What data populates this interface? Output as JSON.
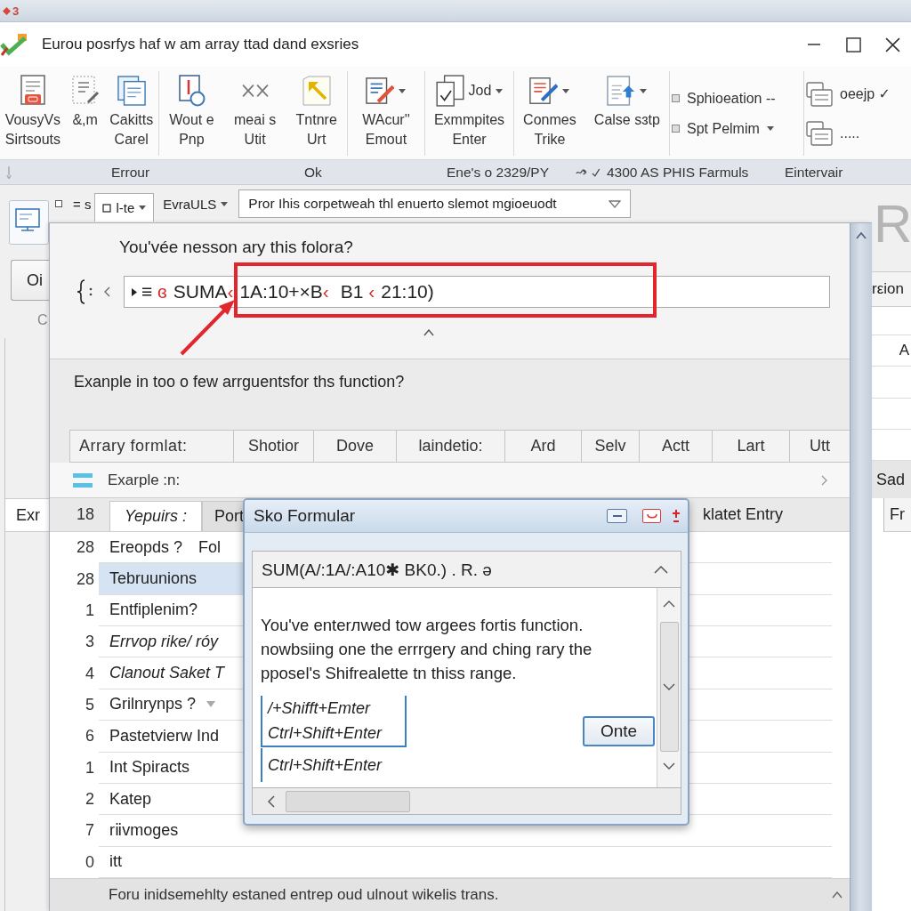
{
  "title_strip": {
    "label": "3"
  },
  "window": {
    "title": "Eurou posrfys haf w am array ttad dand exsries"
  },
  "ribbon": {
    "groups": [
      {
        "kind": "large",
        "buttons": [
          {
            "lines": [
              "VousyVs",
              "Sirtsouts"
            ],
            "dropdown": false
          },
          {
            "lines": [
              "&,m"
            ],
            "dropdown": false
          },
          {
            "lines": [
              "Cakitts",
              "Carel"
            ],
            "dropdown": false
          }
        ]
      },
      {
        "kind": "large",
        "buttons": [
          {
            "lines": [
              "Wout e",
              "Pnp"
            ],
            "dropdown": false
          },
          {
            "lines": [
              "meai s",
              "Utit"
            ],
            "dropdown": false
          },
          {
            "lines": [
              "Tntnre",
              "Urt"
            ],
            "dropdown": false
          }
        ]
      },
      {
        "kind": "large",
        "buttons": [
          {
            "lines": [
              "WAcur''",
              "Emout"
            ],
            "dropdown": true
          }
        ]
      },
      {
        "kind": "large",
        "buttons": [
          {
            "side_label": "Jod",
            "lines": [
              "Exmmpites",
              "Enter"
            ],
            "dropdown": true
          }
        ]
      },
      {
        "kind": "large",
        "buttons": [
          {
            "lines": [
              "Conmes",
              "Trike"
            ],
            "dropdown": true
          },
          {
            "lines": [
              "Calse sɜtp"
            ],
            "dropdown": true
          }
        ]
      },
      {
        "kind": "compact",
        "buttons": [
          {
            "lines": [
              "Sphioeation --"
            ],
            "dropdown": false
          },
          {
            "lines": [
              "Spt Pelmim"
            ],
            "dropdown": true
          }
        ]
      },
      {
        "kind": "compact",
        "buttons": [
          {
            "lines": [
              "oeejp ✓"
            ],
            "dropdown": false
          },
          {
            "lines": [
              "....."
            ],
            "dropdown": false
          }
        ]
      }
    ],
    "group_labels": [
      "Errour",
      "Ok",
      "Ene's o 2329/PY",
      "4300 AS PHIS Farmuls",
      "Eintervair"
    ]
  },
  "workspace": {
    "toolbar": {
      "label": "= s",
      "dropdowns": [
        {
          "kind": "boxed",
          "value": "l-te"
        },
        {
          "kind": "plain",
          "value": "EvraULS"
        }
      ],
      "combo": "Pror Ihis corpetweah thl enuerto slemot mgioeuodt"
    },
    "left": {
      "button": "Oi",
      "letter": "C",
      "tab": "Exr"
    },
    "right": {
      "letter": "R",
      "button": "rεion",
      "cell": "A",
      "band": "Sad",
      "tab": "Fr"
    }
  },
  "panel": {
    "question": "You'vée nesson ary this folora?",
    "formula": [
      {
        "text": "≡ ",
        "error": false
      },
      {
        "text": "ɞ",
        "error": true
      },
      {
        "text": "SUMA",
        "error": false
      },
      {
        "text": "‹",
        "error": true
      },
      {
        "text": "1A:10+×B",
        "error": false
      },
      {
        "text": "‹",
        "error": true
      },
      {
        "text": " B1 ",
        "error": false
      },
      {
        "text": "‹",
        "error": true
      },
      {
        "text": "21:10)",
        "error": false
      }
    ],
    "hint": "Exanple in too o few arrguentsfor ths function?",
    "columns": [
      "Arrary formlat:",
      "Shotior",
      "Dove",
      "laindetio:",
      "Ard",
      "Selv",
      "Actt",
      "Lart",
      "Utt"
    ],
    "section": "Exarple :n:",
    "tab_row": {
      "number": "18",
      "tabs": [
        {
          "label": "Yepuirs :",
          "selected": true
        },
        {
          "label": "Port",
          "selected": false
        }
      ],
      "trailing": "klatet Entry"
    },
    "rows": [
      {
        "number": "28",
        "label": "Ereopds ?",
        "extra": "Fol",
        "selected": false,
        "italic": false,
        "dropdown": false
      },
      {
        "number": "28",
        "label": "Tebruunions",
        "selected": true,
        "italic": false,
        "dropdown": false
      },
      {
        "number": "1",
        "label": "Entfiplenim?",
        "selected": false,
        "italic": false,
        "dropdown": false
      },
      {
        "number": "3",
        "label": "Errvop rike/ róy",
        "selected": false,
        "italic": true,
        "dropdown": false
      },
      {
        "number": "4",
        "label": "Clanout Saket T",
        "selected": false,
        "italic": true,
        "dropdown": false
      },
      {
        "number": "5",
        "label": "Grilnrynps ?",
        "selected": false,
        "italic": false,
        "dropdown": true
      },
      {
        "number": "6",
        "label": "Pastetvierw Ind",
        "selected": false,
        "italic": false,
        "dropdown": false
      },
      {
        "number": "1",
        "label": "Int Spiracts",
        "selected": false,
        "italic": false,
        "dropdown": false
      },
      {
        "number": "2",
        "label": "Katep",
        "selected": false,
        "italic": false,
        "dropdown": false
      },
      {
        "number": "7",
        "label": "rⅱvmoges",
        "selected": false,
        "italic": false,
        "dropdown": false
      },
      {
        "number": "0",
        "label": "itt",
        "selected": false,
        "italic": false,
        "dropdown": false
      }
    ],
    "status": "Foru inidsemehlty estaned entrep oud ulnout wikelis trans."
  },
  "dialog": {
    "title": "Sko Formular",
    "formula": "SUM(A/:1A/:A10✱ BK0.) . R. ə",
    "message": "You've enterлwed tow argees fortis function. nowbsiing one the errrgery and ching rary the pposel's Shifrealette tn thiss range.",
    "shortcuts": [
      {
        "label": "/+Shifft+Emter",
        "boxed": true
      },
      {
        "label": "Ctrl+Shift+Enter",
        "boxed": true
      },
      {
        "label": "Ctrl+Shift+Enter",
        "boxed": false
      }
    ],
    "button": "Onte"
  }
}
